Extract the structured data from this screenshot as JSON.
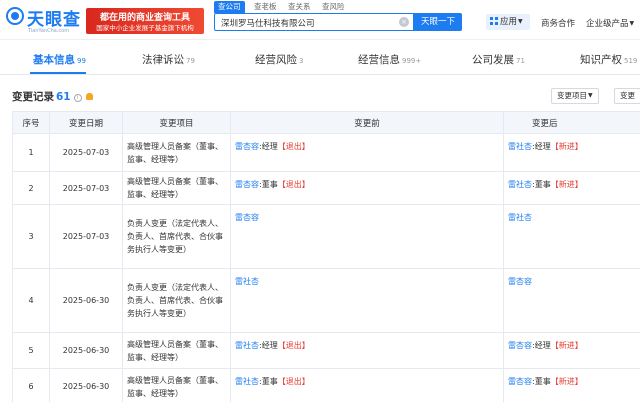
{
  "header": {
    "logo_text": "天眼查",
    "logo_sub": "TianYanCha.com",
    "ad_line1": "都在用的商业查询工具",
    "ad_line2": "国家中小企业发展子基金旗下机构",
    "search_tabs": [
      "查公司",
      "查老板",
      "查关系",
      "查风险"
    ],
    "search_value": "深圳罗马仕科技有限公司",
    "search_button": "天眼一下",
    "nav": {
      "apps": "应用",
      "business": "商务合作",
      "enterprise": "企业级产品"
    }
  },
  "tabs": [
    {
      "label": "基本信息",
      "count": "99"
    },
    {
      "label": "法律诉讼",
      "count": "79"
    },
    {
      "label": "经营风险",
      "count": "3"
    },
    {
      "label": "经营信息",
      "count": "999+"
    },
    {
      "label": "公司发展",
      "count": "71"
    },
    {
      "label": "知识产权",
      "count": "519"
    }
  ],
  "section": {
    "title": "变更记录",
    "count": "61",
    "filter_item": "变更项目",
    "filter_date": "变更"
  },
  "table": {
    "columns": [
      "序号",
      "变更日期",
      "变更项目",
      "变更前",
      "变更后"
    ],
    "rows": [
      {
        "no": "1",
        "date": "2025-07-03",
        "item": "高级管理人员备案（董事、监事、经理等）",
        "before_name": "雷杏容",
        "before_role": ":经理",
        "before_tag": "【退出】",
        "after_name": "雷社杏",
        "after_role": ":经理",
        "after_tag": "【新进】"
      },
      {
        "no": "2",
        "date": "2025-07-03",
        "item": "高级管理人员备案（董事、监事、经理等）",
        "before_name": "雷杏容",
        "before_role": ":董事",
        "before_tag": "【退出】",
        "after_name": "雷社杏",
        "after_role": ":董事",
        "after_tag": "【新进】"
      },
      {
        "no": "3",
        "date": "2025-07-03",
        "item": "负责人变更（法定代表人、负责人、首席代表、合伙事务执行人等变更）",
        "before_name": "雷杏容",
        "before_role": "",
        "before_tag": "",
        "after_name": "雷社杏",
        "after_role": "",
        "after_tag": ""
      },
      {
        "no": "4",
        "date": "2025-06-30",
        "item": "负责人变更（法定代表人、负责人、首席代表、合伙事务执行人等变更）",
        "before_name": "雷社杏",
        "before_role": "",
        "before_tag": "",
        "after_name": "雷杏容",
        "after_role": "",
        "after_tag": ""
      },
      {
        "no": "5",
        "date": "2025-06-30",
        "item": "高级管理人员备案（董事、监事、经理等）",
        "before_name": "雷社杏",
        "before_role": ":经理",
        "before_tag": "【退出】",
        "after_name": "雷杏容",
        "after_role": ":经理",
        "after_tag": "【新进】"
      },
      {
        "no": "6",
        "date": "2025-06-30",
        "item": "高级管理人员备案（董事、监事、经理等）",
        "before_name": "雷社杏",
        "before_role": ":董事",
        "before_tag": "【退出】",
        "after_name": "雷杏容",
        "after_role": ":董事",
        "after_tag": "【新进】"
      }
    ]
  },
  "colors": {
    "accent": "#1d7df0",
    "danger": "#e63c33",
    "header_bg": "#f3f6fa"
  }
}
